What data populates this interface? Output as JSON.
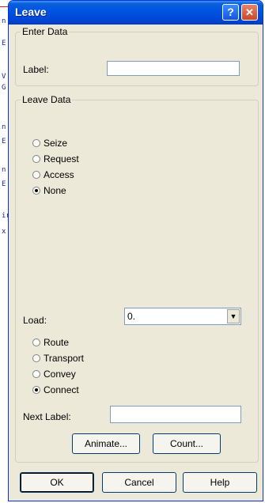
{
  "background_app": {
    "marks": [
      "n",
      "E",
      "V",
      "G",
      "n",
      "E",
      "n",
      "E",
      "ir",
      "x"
    ]
  },
  "window": {
    "title": "Leave",
    "help_glyph": "?",
    "close_glyph": "✕"
  },
  "enter_data": {
    "legend": "Enter Data",
    "label_caption": "Label:",
    "label_value": ""
  },
  "leave_data": {
    "legend": "Leave Data",
    "resource_options": [
      {
        "label": "Seize",
        "checked": false
      },
      {
        "label": "Request",
        "checked": false
      },
      {
        "label": "Access",
        "checked": false
      },
      {
        "label": "None",
        "checked": true
      }
    ],
    "load_caption": "Load:",
    "load_value": "0.",
    "move_options": [
      {
        "label": "Route",
        "checked": false
      },
      {
        "label": "Transport",
        "checked": false
      },
      {
        "label": "Convey",
        "checked": false
      },
      {
        "label": "Connect",
        "checked": true
      }
    ],
    "next_label_caption": "Next Label:",
    "next_label_value": "",
    "animate_button": "Animate...",
    "count_button": "Count..."
  },
  "footer": {
    "ok_button": "OK",
    "cancel_button": "Cancel",
    "help_button": "Help"
  },
  "colors": {
    "titlebar": "#0054e3",
    "dialog_bg": "#ece9d8",
    "close_button": "#c94a2a"
  }
}
